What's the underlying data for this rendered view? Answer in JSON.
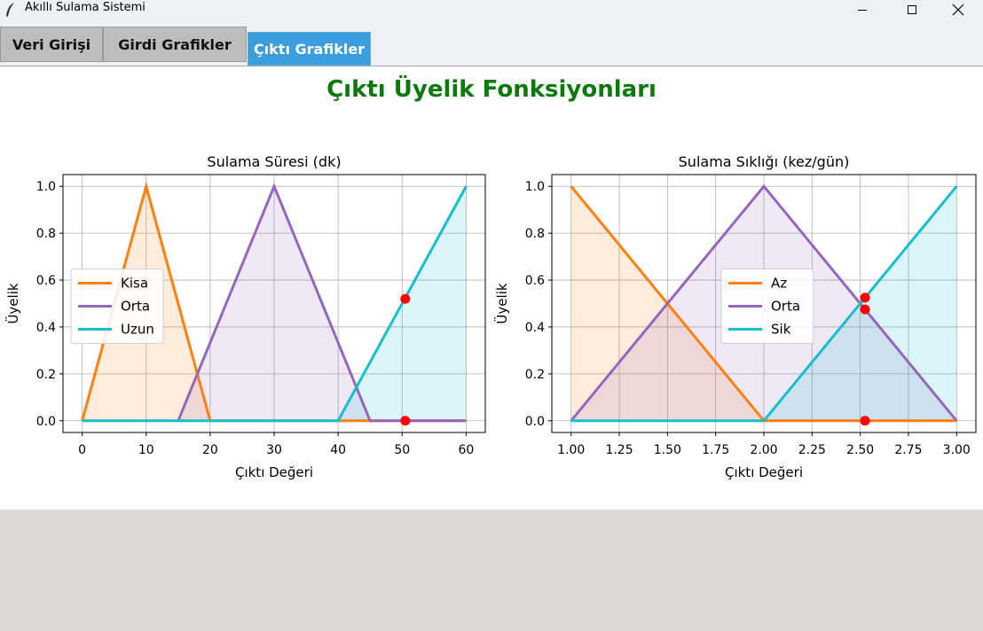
{
  "window": {
    "title": "Akıllı Sulama Sistemi"
  },
  "tabs": [
    {
      "label": "Veri Girişi",
      "active": false
    },
    {
      "label": "Girdi Grafikler",
      "active": false
    },
    {
      "label": "Çıktı Grafikler",
      "active": true
    }
  ],
  "page": {
    "heading": "Çıktı Üyelik Fonksiyonları"
  },
  "colors": {
    "orange": "#ff7f0e",
    "purple": "#9467bd",
    "cyan": "#17becf",
    "marker": "#ff0000",
    "heading": "#0a7a0a",
    "tab_active": "#3a9ddc"
  },
  "chart_data": [
    {
      "type": "line",
      "title": "Sulama Süresi (dk)",
      "xlabel": "Çıktı Değeri",
      "ylabel": "Üyelik",
      "xlim": [
        -3,
        63
      ],
      "ylim": [
        -0.05,
        1.05
      ],
      "xticks": [
        0,
        10,
        20,
        30,
        40,
        50,
        60
      ],
      "xtick_labels": [
        "0",
        "10",
        "20",
        "30",
        "40",
        "50",
        "60"
      ],
      "yticks": [
        0,
        0.2,
        0.4,
        0.6,
        0.8,
        1.0
      ],
      "ytick_labels": [
        "0.0",
        "0.2",
        "0.4",
        "0.6",
        "0.8",
        "1.0"
      ],
      "grid": true,
      "legend_position": "center-left",
      "series": [
        {
          "name": "Kisa",
          "color": "#ff7f0e",
          "points": [
            [
              0,
              0
            ],
            [
              10,
              1
            ],
            [
              20,
              0
            ],
            [
              45,
              0
            ],
            [
              60,
              0
            ]
          ]
        },
        {
          "name": "Orta",
          "color": "#9467bd",
          "points": [
            [
              15,
              0
            ],
            [
              30,
              1
            ],
            [
              45,
              0
            ],
            [
              60,
              0
            ]
          ]
        },
        {
          "name": "Uzun",
          "color": "#17becf",
          "points": [
            [
              0,
              0
            ],
            [
              40,
              0
            ],
            [
              60,
              1
            ]
          ]
        }
      ],
      "fills": [
        {
          "color": "#ff7f0e",
          "points": [
            [
              0,
              0
            ],
            [
              10,
              1
            ],
            [
              20,
              0
            ]
          ]
        },
        {
          "color": "#9467bd",
          "points": [
            [
              15,
              0
            ],
            [
              30,
              1
            ],
            [
              45,
              0
            ]
          ]
        },
        {
          "color": "#17becf",
          "points": [
            [
              40,
              0
            ],
            [
              60,
              1
            ],
            [
              60,
              0
            ]
          ]
        }
      ],
      "markers": [
        [
          50.5,
          0.52
        ],
        [
          50.5,
          0
        ]
      ]
    },
    {
      "type": "line",
      "title": "Sulama Sıklığı (kez/gün)",
      "xlabel": "Çıktı Değeri",
      "ylabel": "Üyelik",
      "xlim": [
        0.9,
        3.1
      ],
      "ylim": [
        -0.05,
        1.05
      ],
      "xticks": [
        1.0,
        1.25,
        1.5,
        1.75,
        2.0,
        2.25,
        2.5,
        2.75,
        3.0
      ],
      "xtick_labels": [
        "1.00",
        "1.25",
        "1.50",
        "1.75",
        "2.00",
        "2.25",
        "2.50",
        "2.75",
        "3.00"
      ],
      "yticks": [
        0,
        0.2,
        0.4,
        0.6,
        0.8,
        1.0
      ],
      "ytick_labels": [
        "0.0",
        "0.2",
        "0.4",
        "0.6",
        "0.8",
        "1.0"
      ],
      "grid": true,
      "legend_position": "center",
      "series": [
        {
          "name": "Az",
          "color": "#ff7f0e",
          "points": [
            [
              1,
              1
            ],
            [
              2,
              0
            ],
            [
              3,
              0
            ]
          ]
        },
        {
          "name": "Orta",
          "color": "#9467bd",
          "points": [
            [
              1,
              0
            ],
            [
              2,
              1
            ],
            [
              3,
              0
            ]
          ]
        },
        {
          "name": "Sik",
          "color": "#17becf",
          "points": [
            [
              1,
              0
            ],
            [
              2,
              0
            ],
            [
              3,
              1
            ]
          ]
        }
      ],
      "fills": [
        {
          "color": "#ff7f0e",
          "points": [
            [
              1,
              1
            ],
            [
              2,
              0
            ],
            [
              1,
              0
            ]
          ]
        },
        {
          "color": "#9467bd",
          "points": [
            [
              1,
              0
            ],
            [
              2,
              1
            ],
            [
              3,
              0
            ]
          ]
        },
        {
          "color": "#17becf",
          "points": [
            [
              2,
              0
            ],
            [
              3,
              1
            ],
            [
              3,
              0
            ]
          ]
        }
      ],
      "markers": [
        [
          2.525,
          0.525
        ],
        [
          2.525,
          0.475
        ],
        [
          2.525,
          0
        ]
      ]
    }
  ]
}
